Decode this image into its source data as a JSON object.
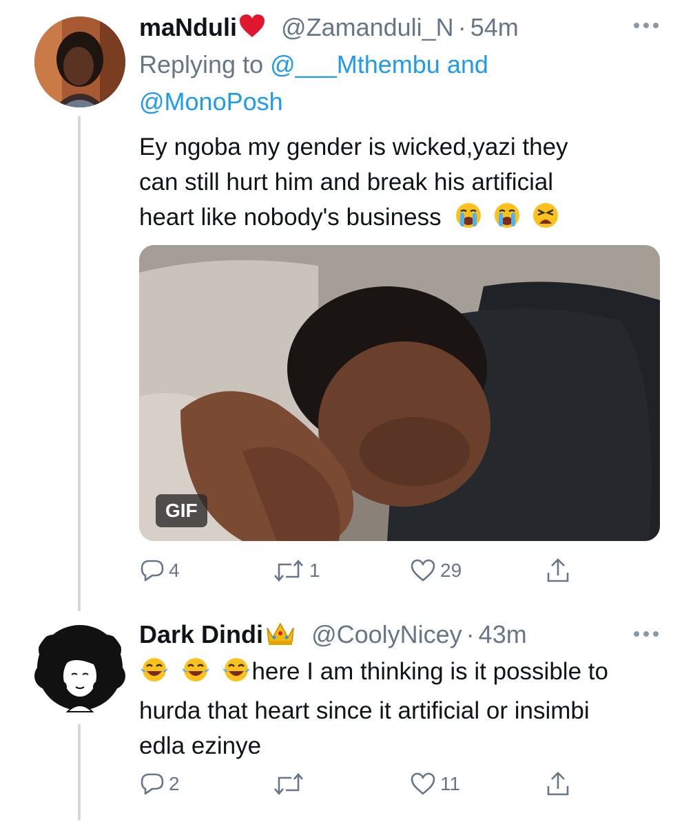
{
  "tweets": [
    {
      "display_name": "maNduli",
      "name_emoji": "red-heart-emoji",
      "handle": "@Zamanduli_N",
      "separator": "·",
      "time": "54m",
      "replying_prefix": "Replying to",
      "replying_to_1": "@___Mthembu",
      "replying_and": "and",
      "replying_to_2": "@MonoPosh",
      "text_line1": "Ey ngoba my gender is wicked,yazi they",
      "text_line2": "can still hurt him and break his artificial",
      "text_line3": "heart like nobody's business",
      "text_emojis": [
        "loudly-crying-face",
        "loudly-crying-face",
        "weary-face"
      ],
      "media_badge": "GIF",
      "replies": "4",
      "retweets": "1",
      "likes": "29"
    },
    {
      "display_name": "Dark Dindi",
      "name_emoji": "crown-emoji",
      "handle": "@CoolyNicey",
      "separator": "·",
      "time": "43m",
      "text_emojis": [
        "face-with-tears-of-joy",
        "face-with-tears-of-joy",
        "face-with-tears-of-joy"
      ],
      "text_line1": "here I am thinking is it possible to",
      "text_line2": "hurda that heart since it artificial or insimbi",
      "text_line3": "edla ezinye",
      "replies": "2",
      "retweets": "",
      "likes": "11"
    }
  ],
  "icons": {
    "more": "more-icon",
    "reply": "reply-icon",
    "retweet": "retweet-icon",
    "like": "like-icon",
    "share": "share-icon"
  },
  "colors": {
    "link": "#1d9bf0",
    "muted": "#657786",
    "thread_line": "#cfd9de"
  }
}
